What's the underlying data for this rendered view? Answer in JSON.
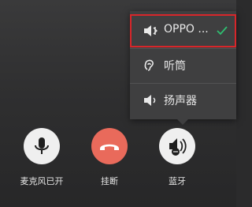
{
  "audio_menu": {
    "items": [
      {
        "label": "OPPO ...",
        "icon": "bluetooth-speaker-icon",
        "selected": true
      },
      {
        "label": "听筒",
        "icon": "earpiece-icon",
        "selected": false
      },
      {
        "label": "扬声器",
        "icon": "speaker-icon",
        "selected": false
      }
    ]
  },
  "controls": {
    "mute_label": "麦克风已开",
    "hangup_label": "挂断",
    "bluetooth_label": "蓝牙"
  },
  "colors": {
    "hangup": "#e96a5b",
    "selection_border": "#d7262a",
    "check": "#2fbf71"
  }
}
